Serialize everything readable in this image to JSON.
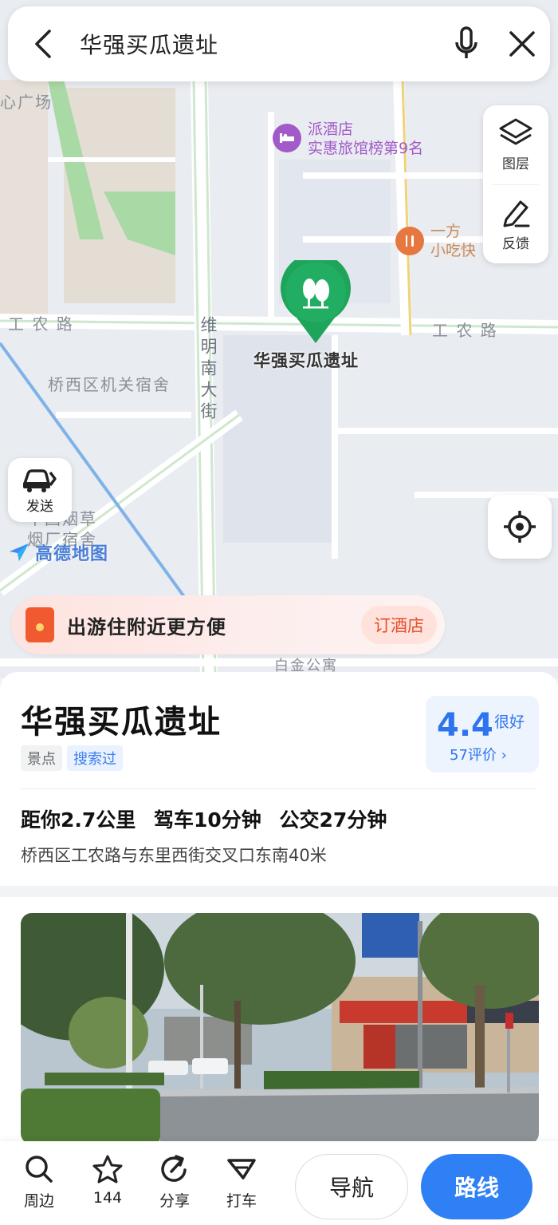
{
  "search": {
    "query": "华强买瓜遗址"
  },
  "map": {
    "road_labels": {
      "gongnong_left": "工 农 路",
      "gongnong_right": "工 农 路",
      "weiming": "维明南大街",
      "jiguan": "桥西区机关宿舍",
      "yancao": "中国烟草",
      "yancao2": "烟厂宿舍",
      "guangchang": "心广场",
      "baijin": "白金公寓"
    },
    "poi": {
      "hotel_name": "派酒店",
      "hotel_sub": "实惠旅馆榜第9名",
      "food_name": "一方",
      "food_sub": "小吃快"
    },
    "marker_label": "华强买瓜遗址",
    "tools": {
      "layers": "图层",
      "feedback": "反馈"
    },
    "send": "发送",
    "logo": "高德地图",
    "promo": {
      "text": "出游住附近更方便",
      "cta": "订酒店"
    }
  },
  "place": {
    "title": "华强买瓜遗址",
    "category": "景点",
    "searched": "搜索过",
    "rating": "4.4",
    "rating_word": "很好",
    "reviews": "57评价 ›",
    "distance": "距你2.7公里",
    "drive": "驾车10分钟",
    "bus": "公交27分钟",
    "address": "桥西区工农路与东里西街交叉口东南40米"
  },
  "bottom": {
    "nearby": "周边",
    "favorites": "144",
    "share": "分享",
    "taxi": "打车",
    "navigate": "导航",
    "route": "路线"
  },
  "colors": {
    "accent": "#2f80f5",
    "marker": "#1fa45c",
    "hotel_poi": "#a25ac8",
    "food_poi": "#e6773f",
    "promo_cta": "#e4502c"
  }
}
